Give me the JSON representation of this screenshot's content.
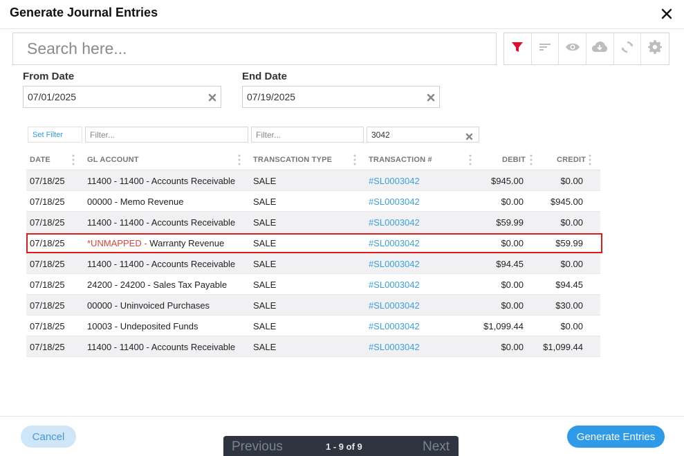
{
  "dialog": {
    "title": "Generate Journal Entries"
  },
  "search": {
    "placeholder": "Search here..."
  },
  "colors": {
    "accent": "#2f9ae8",
    "filter_active": "#e0102a",
    "unmapped": "#e0433c",
    "highlight": "#e01919"
  },
  "toolbar": {
    "icons": [
      "filter-icon",
      "sort-icon",
      "eye-icon",
      "cloud-download-icon",
      "refresh-icon",
      "gear-icon"
    ]
  },
  "dates": {
    "from_label": "From Date",
    "from_value": "07/01/2025",
    "end_label": "End Date",
    "end_value": "07/19/2025"
  },
  "filters": {
    "set_filter_label": "Set Filter",
    "gl_account_placeholder": "Filter...",
    "type_placeholder": "Filter...",
    "transaction_value": "3042"
  },
  "grid": {
    "columns": [
      "DATE",
      "GL ACCOUNT",
      "TRANSCATION TYPE",
      "TRANSACTION #",
      "DEBIT",
      "CREDIT"
    ],
    "rows": [
      {
        "date": "07/18/25",
        "gl_prefix": "",
        "gl": "11400 - 11400 - Accounts Receivable",
        "type": "SALE",
        "txn": "#SL0003042",
        "debit": "$945.00",
        "credit": "$0.00"
      },
      {
        "date": "07/18/25",
        "gl_prefix": "",
        "gl": "00000 - Memo Revenue",
        "type": "SALE",
        "txn": "#SL0003042",
        "debit": "$0.00",
        "credit": "$945.00"
      },
      {
        "date": "07/18/25",
        "gl_prefix": "",
        "gl": "11400 - 11400 - Accounts Receivable",
        "type": "SALE",
        "txn": "#SL0003042",
        "debit": "$59.99",
        "credit": "$0.00"
      },
      {
        "date": "07/18/25",
        "gl_prefix": "*UNMAPPED - ",
        "gl": "Warranty Revenue",
        "type": "SALE",
        "txn": "#SL0003042",
        "debit": "$0.00",
        "credit": "$59.99"
      },
      {
        "date": "07/18/25",
        "gl_prefix": "",
        "gl": "11400 - 11400 - Accounts Receivable",
        "type": "SALE",
        "txn": "#SL0003042",
        "debit": "$94.45",
        "credit": "$0.00"
      },
      {
        "date": "07/18/25",
        "gl_prefix": "",
        "gl": "24200 - 24200 - Sales Tax Payable",
        "type": "SALE",
        "txn": "#SL0003042",
        "debit": "$0.00",
        "credit": "$94.45"
      },
      {
        "date": "07/18/25",
        "gl_prefix": "",
        "gl": "00000 - Uninvoiced Purchases",
        "type": "SALE",
        "txn": "#SL0003042",
        "debit": "$0.00",
        "credit": "$30.00"
      },
      {
        "date": "07/18/25",
        "gl_prefix": "",
        "gl": "10003 - Undeposited Funds",
        "type": "SALE",
        "txn": "#SL0003042",
        "debit": "$1,099.44",
        "credit": "$0.00"
      },
      {
        "date": "07/18/25",
        "gl_prefix": "",
        "gl": "11400 - 11400 - Accounts Receivable",
        "type": "SALE",
        "txn": "#SL0003042",
        "debit": "$0.00",
        "credit": "$1,099.44"
      }
    ]
  },
  "footer": {
    "cancel_label": "Cancel",
    "generate_label": "Generate Entries",
    "prev_label": "Previous",
    "page_info": "1 - 9 of 9",
    "next_label": "Next"
  }
}
